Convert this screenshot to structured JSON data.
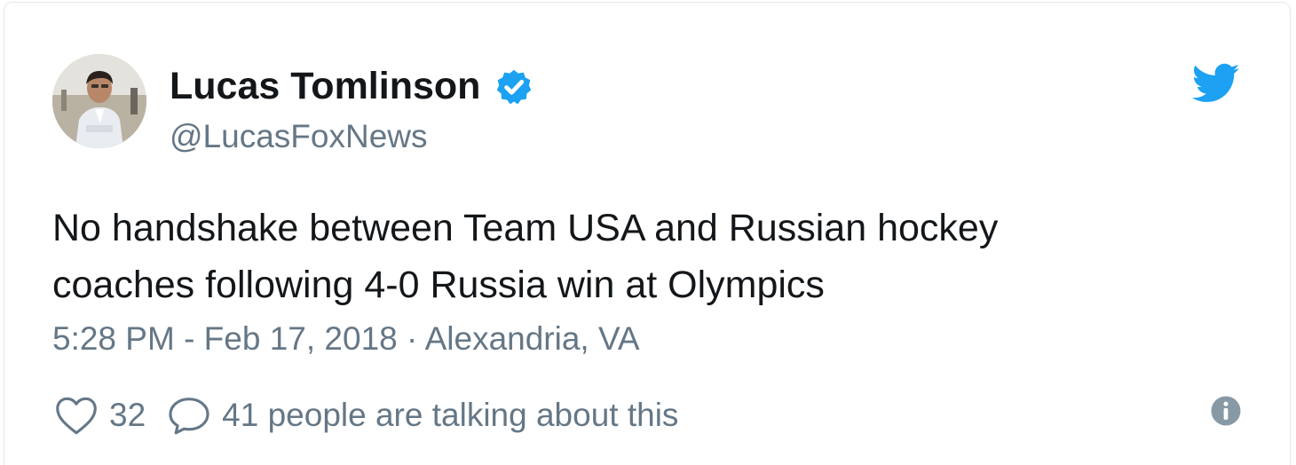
{
  "author": {
    "name": "Lucas Tomlinson",
    "handle": "@LucasFoxNews",
    "verified": true
  },
  "tweet": {
    "text_line1": "No handshake between Team USA and Russian hockey",
    "text_line2": "coaches following 4-0 Russia win at Olympics"
  },
  "meta": {
    "timestamp": "5:28 PM - Feb 17, 2018",
    "separator": " · ",
    "location": "Alexandria, VA"
  },
  "actions": {
    "like_count": "32",
    "conversation_text": "41 people are talking about this"
  },
  "icons": {
    "brand": "twitter-bird-icon",
    "verified": "verified-badge-icon",
    "like": "heart-icon",
    "reply": "speech-bubble-icon",
    "info": "info-icon"
  },
  "colors": {
    "twitter_blue": "#1da1f2",
    "text_primary": "#14171a",
    "text_secondary": "#657786",
    "border": "#e1e8ed"
  }
}
